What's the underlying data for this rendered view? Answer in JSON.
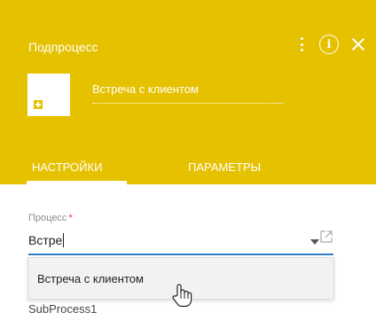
{
  "header": {
    "title": "Подпроцесс",
    "element_name": "Встреча с клиентом",
    "accent_color": "#e5c100",
    "icons": [
      "more-vertical-icon",
      "info-icon",
      "close-icon"
    ]
  },
  "tabs": [
    {
      "label": "Настройки",
      "active": true
    },
    {
      "label": "Параметры",
      "active": false
    }
  ],
  "process_field": {
    "label": "Процесс",
    "required_mark": "*",
    "value": "Встре",
    "focus_color": "#2a7ec6"
  },
  "dropdown": {
    "options": [
      "Встреча с клиентом"
    ]
  },
  "below_text": "SubProcess1"
}
